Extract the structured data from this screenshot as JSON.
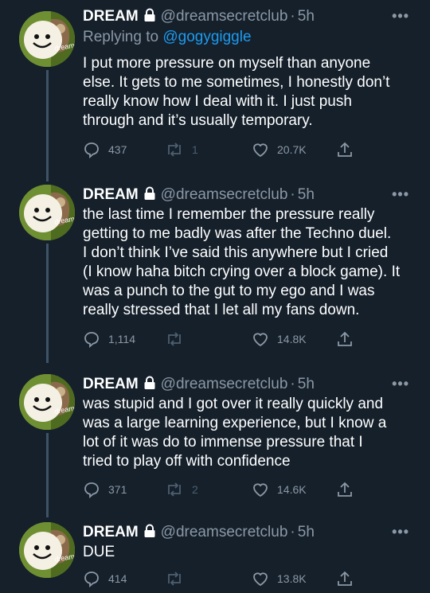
{
  "author": {
    "name": "DREAM",
    "handle": "@dreamsecretclub",
    "avatar_text": "dream"
  },
  "tweets": [
    {
      "time": "5h",
      "replying_prefix": "Replying to ",
      "replying_to": "@gogygiggle",
      "text": "I put more pressure on myself than anyone\nelse. It gets to me sometimes, I honestly don’t\nreally know how I deal with it. I just push\nthrough and it’s usually temporary.",
      "replies": "437",
      "retweets": "1",
      "likes": "20.7K"
    },
    {
      "time": "5h",
      "text": "the last time I remember the pressure really\ngetting to me badly was after the Techno duel.\nI don’t think I’ve said this anywhere but I cried\n(I know haha bitch crying over a block game). It\nwas a punch to the gut to my ego and I was\nreally stressed that I let all my fans down.",
      "replies": "1,114",
      "retweets": "",
      "likes": "14.8K"
    },
    {
      "time": "5h",
      "text": "was stupid and I got over it really quickly and\nwas a large learning experience, but I know a\nlot of it was do to immense pressure that I\ntried to play off with confidence",
      "replies": "371",
      "retweets": "2",
      "likes": "14.6K"
    },
    {
      "time": "5h",
      "text": "DUE",
      "replies": "414",
      "retweets": "",
      "likes": "13.8K"
    }
  ],
  "icons": {
    "lock": "lock-icon",
    "more": "more-icon",
    "reply": "reply-icon",
    "retweet": "retweet-icon",
    "like": "heart-icon",
    "share": "share-icon"
  },
  "colors": {
    "background": "#15202b",
    "secondary_text": "#8b98a5",
    "link": "#1d9bf0",
    "thread_line": "#3d5466"
  },
  "more_glyph": "•••"
}
